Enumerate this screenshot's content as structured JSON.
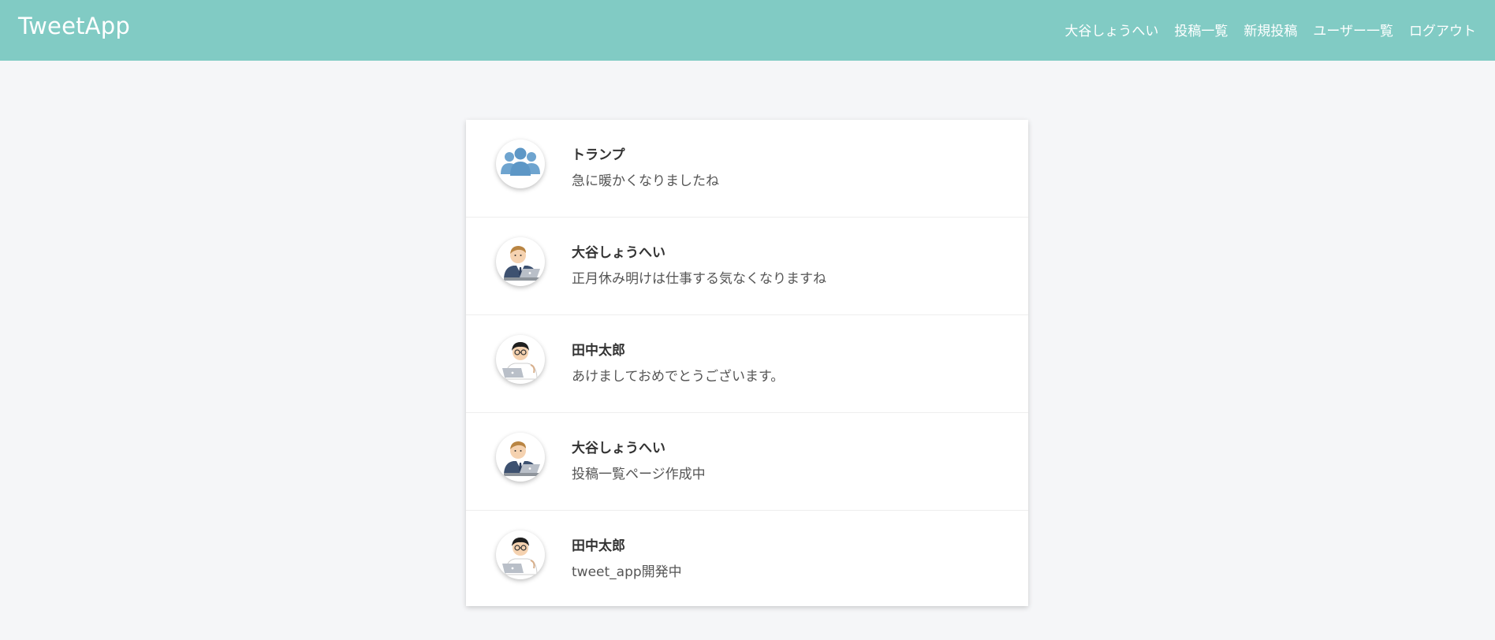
{
  "header": {
    "logo": "TweetApp",
    "nav": {
      "user": "大谷しょうへい",
      "posts": "投稿一覧",
      "new_post": "新規投稿",
      "users": "ユーザー一覧",
      "logout": "ログアウト"
    }
  },
  "posts": [
    {
      "user": "トランプ",
      "text": "急に暖かくなりましたね",
      "avatar": "group-icon"
    },
    {
      "user": "大谷しょうへい",
      "text": "正月休み明けは仕事する気なくなりますね",
      "avatar": "businessman-laptop-avatar"
    },
    {
      "user": "田中太郎",
      "text": "あけましておめでとうございます。",
      "avatar": "glasses-man-laptop-avatar"
    },
    {
      "user": "大谷しょうへい",
      "text": "投稿一覧ページ作成中",
      "avatar": "businessman-laptop-avatar"
    },
    {
      "user": "田中太郎",
      "text": "tweet_app開発中",
      "avatar": "glasses-man-laptop-avatar"
    }
  ],
  "colors": {
    "header_bg": "#81cbc4",
    "page_bg": "#f5f6f8"
  }
}
